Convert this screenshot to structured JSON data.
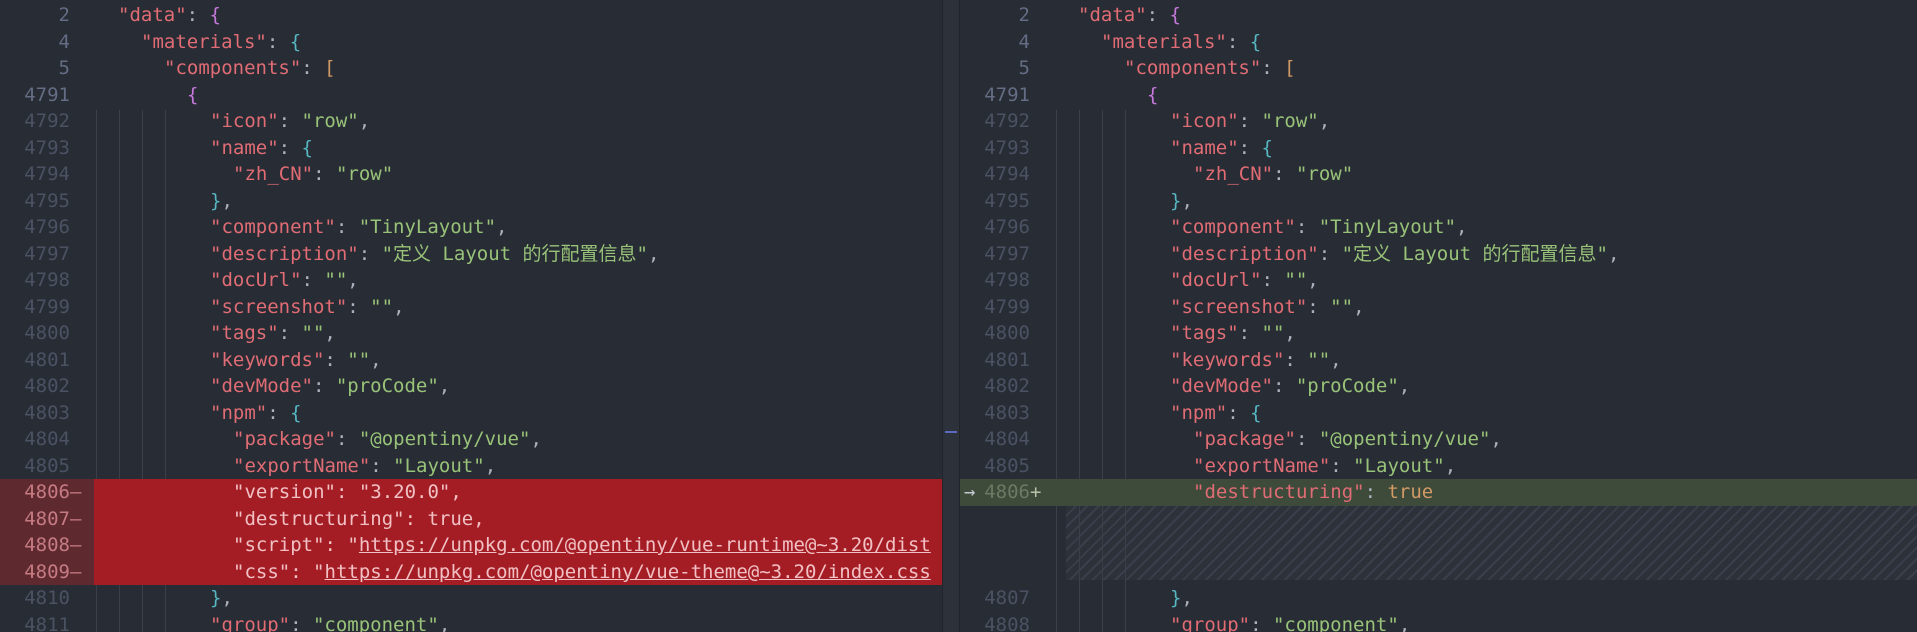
{
  "left": {
    "lines": [
      {
        "num": "2",
        "sign": "",
        "type": "ctx",
        "top": true,
        "indent": 0,
        "tokens": [
          {
            "t": "\"data\"",
            "c": "k"
          },
          {
            "t": ": ",
            "c": "p"
          },
          {
            "t": "{",
            "c": "b1"
          }
        ]
      },
      {
        "num": "4",
        "sign": "",
        "type": "ctx",
        "top": true,
        "indent": 1,
        "tokens": [
          {
            "t": "\"materials\"",
            "c": "k"
          },
          {
            "t": ": ",
            "c": "p"
          },
          {
            "t": "{",
            "c": "b2"
          }
        ]
      },
      {
        "num": "5",
        "sign": "",
        "type": "ctx",
        "top": true,
        "indent": 2,
        "tokens": [
          {
            "t": "\"components\"",
            "c": "k"
          },
          {
            "t": ": ",
            "c": "p"
          },
          {
            "t": "[",
            "c": "b3"
          }
        ]
      },
      {
        "num": "4791",
        "sign": "",
        "type": "ctx",
        "top": true,
        "indent": 3,
        "tokens": [
          {
            "t": "{",
            "c": "b1"
          }
        ]
      },
      {
        "num": "4792",
        "sign": "",
        "type": "ctx",
        "indent": 4,
        "tokens": [
          {
            "t": "\"icon\"",
            "c": "k"
          },
          {
            "t": ": ",
            "c": "p"
          },
          {
            "t": "\"row\"",
            "c": "s"
          },
          {
            "t": ",",
            "c": "p"
          }
        ]
      },
      {
        "num": "4793",
        "sign": "",
        "type": "ctx",
        "indent": 4,
        "tokens": [
          {
            "t": "\"name\"",
            "c": "k"
          },
          {
            "t": ": ",
            "c": "p"
          },
          {
            "t": "{",
            "c": "b2"
          }
        ]
      },
      {
        "num": "4794",
        "sign": "",
        "type": "ctx",
        "indent": 5,
        "tokens": [
          {
            "t": "\"zh_CN\"",
            "c": "k"
          },
          {
            "t": ": ",
            "c": "p"
          },
          {
            "t": "\"row\"",
            "c": "s"
          }
        ]
      },
      {
        "num": "4795",
        "sign": "",
        "type": "ctx",
        "indent": 4,
        "tokens": [
          {
            "t": "}",
            "c": "b2"
          },
          {
            "t": ",",
            "c": "p"
          }
        ]
      },
      {
        "num": "4796",
        "sign": "",
        "type": "ctx",
        "indent": 4,
        "tokens": [
          {
            "t": "\"component\"",
            "c": "k"
          },
          {
            "t": ": ",
            "c": "p"
          },
          {
            "t": "\"TinyLayout\"",
            "c": "s"
          },
          {
            "t": ",",
            "c": "p"
          }
        ]
      },
      {
        "num": "4797",
        "sign": "",
        "type": "ctx",
        "indent": 4,
        "tokens": [
          {
            "t": "\"description\"",
            "c": "k"
          },
          {
            "t": ": ",
            "c": "p"
          },
          {
            "t": "\"定义 Layout 的行配置信息\"",
            "c": "s"
          },
          {
            "t": ",",
            "c": "p"
          }
        ]
      },
      {
        "num": "4798",
        "sign": "",
        "type": "ctx",
        "indent": 4,
        "tokens": [
          {
            "t": "\"docUrl\"",
            "c": "k"
          },
          {
            "t": ": ",
            "c": "p"
          },
          {
            "t": "\"\"",
            "c": "s"
          },
          {
            "t": ",",
            "c": "p"
          }
        ]
      },
      {
        "num": "4799",
        "sign": "",
        "type": "ctx",
        "indent": 4,
        "tokens": [
          {
            "t": "\"screenshot\"",
            "c": "k"
          },
          {
            "t": ": ",
            "c": "p"
          },
          {
            "t": "\"\"",
            "c": "s"
          },
          {
            "t": ",",
            "c": "p"
          }
        ]
      },
      {
        "num": "4800",
        "sign": "",
        "type": "ctx",
        "indent": 4,
        "tokens": [
          {
            "t": "\"tags\"",
            "c": "k"
          },
          {
            "t": ": ",
            "c": "p"
          },
          {
            "t": "\"\"",
            "c": "s"
          },
          {
            "t": ",",
            "c": "p"
          }
        ]
      },
      {
        "num": "4801",
        "sign": "",
        "type": "ctx",
        "indent": 4,
        "tokens": [
          {
            "t": "\"keywords\"",
            "c": "k"
          },
          {
            "t": ": ",
            "c": "p"
          },
          {
            "t": "\"\"",
            "c": "s"
          },
          {
            "t": ",",
            "c": "p"
          }
        ]
      },
      {
        "num": "4802",
        "sign": "",
        "type": "ctx",
        "indent": 4,
        "tokens": [
          {
            "t": "\"devMode\"",
            "c": "k"
          },
          {
            "t": ": ",
            "c": "p"
          },
          {
            "t": "\"proCode\"",
            "c": "s"
          },
          {
            "t": ",",
            "c": "p"
          }
        ]
      },
      {
        "num": "4803",
        "sign": "",
        "type": "ctx",
        "indent": 4,
        "tokens": [
          {
            "t": "\"npm\"",
            "c": "k"
          },
          {
            "t": ": ",
            "c": "p"
          },
          {
            "t": "{",
            "c": "b2"
          }
        ]
      },
      {
        "num": "4804",
        "sign": "",
        "type": "ctx",
        "indent": 5,
        "tokens": [
          {
            "t": "\"package\"",
            "c": "k"
          },
          {
            "t": ": ",
            "c": "p"
          },
          {
            "t": "\"@opentiny/vue\"",
            "c": "s"
          },
          {
            "t": ",",
            "c": "p"
          }
        ]
      },
      {
        "num": "4805",
        "sign": "",
        "type": "ctx",
        "indent": 5,
        "tokens": [
          {
            "t": "\"exportName\"",
            "c": "k"
          },
          {
            "t": ": ",
            "c": "p"
          },
          {
            "t": "\"Layout\"",
            "c": "s"
          },
          {
            "t": ",",
            "c": "p"
          }
        ]
      },
      {
        "num": "4806",
        "sign": "–",
        "type": "del",
        "indent": 5,
        "tokens": [
          {
            "t": "\"version\"",
            "c": "k"
          },
          {
            "t": ": ",
            "c": "p"
          },
          {
            "t": "\"3.20.0\"",
            "c": "s"
          },
          {
            "t": ",",
            "c": "p"
          }
        ]
      },
      {
        "num": "4807",
        "sign": "–",
        "type": "del",
        "indent": 5,
        "tokens": [
          {
            "t": "\"destructuring\"",
            "c": "k"
          },
          {
            "t": ": ",
            "c": "p"
          },
          {
            "t": "true",
            "c": "p"
          },
          {
            "t": ",",
            "c": "p"
          }
        ]
      },
      {
        "num": "4808",
        "sign": "–",
        "type": "del",
        "indent": 5,
        "tokens": [
          {
            "t": "\"script\"",
            "c": "k"
          },
          {
            "t": ": ",
            "c": "p"
          },
          {
            "t": "\"",
            "c": "s"
          },
          {
            "t": "https://unpkg.com/@opentiny/vue-runtime@~3.20/dist",
            "c": "s url"
          }
        ]
      },
      {
        "num": "4809",
        "sign": "–",
        "type": "del",
        "indent": 5,
        "tokens": [
          {
            "t": "\"css\"",
            "c": "k"
          },
          {
            "t": ": ",
            "c": "p"
          },
          {
            "t": "\"",
            "c": "s"
          },
          {
            "t": "https://unpkg.com/@opentiny/vue-theme@~3.20/index.css",
            "c": "s url"
          }
        ]
      },
      {
        "num": "4810",
        "sign": "",
        "type": "ctx",
        "indent": 4,
        "tokens": [
          {
            "t": "}",
            "c": "b2"
          },
          {
            "t": ",",
            "c": "p"
          }
        ]
      },
      {
        "num": "4811",
        "sign": "",
        "type": "ctx",
        "indent": 4,
        "tokens": [
          {
            "t": "\"group\"",
            "c": "k"
          },
          {
            "t": ": ",
            "c": "p"
          },
          {
            "t": "\"component\"",
            "c": "s"
          },
          {
            "t": ",",
            "c": "p"
          }
        ]
      }
    ]
  },
  "right": {
    "lines": [
      {
        "num": "2",
        "sign": "",
        "type": "ctx",
        "top": true,
        "indent": 0,
        "tokens": [
          {
            "t": "\"data\"",
            "c": "k"
          },
          {
            "t": ": ",
            "c": "p"
          },
          {
            "t": "{",
            "c": "b1"
          }
        ]
      },
      {
        "num": "4",
        "sign": "",
        "type": "ctx",
        "top": true,
        "indent": 1,
        "tokens": [
          {
            "t": "\"materials\"",
            "c": "k"
          },
          {
            "t": ": ",
            "c": "p"
          },
          {
            "t": "{",
            "c": "b2"
          }
        ]
      },
      {
        "num": "5",
        "sign": "",
        "type": "ctx",
        "top": true,
        "indent": 2,
        "tokens": [
          {
            "t": "\"components\"",
            "c": "k"
          },
          {
            "t": ": ",
            "c": "p"
          },
          {
            "t": "[",
            "c": "b3"
          }
        ]
      },
      {
        "num": "4791",
        "sign": "",
        "type": "ctx",
        "top": true,
        "indent": 3,
        "tokens": [
          {
            "t": "{",
            "c": "b1"
          }
        ]
      },
      {
        "num": "4792",
        "sign": "",
        "type": "ctx",
        "indent": 4,
        "tokens": [
          {
            "t": "\"icon\"",
            "c": "k"
          },
          {
            "t": ": ",
            "c": "p"
          },
          {
            "t": "\"row\"",
            "c": "s"
          },
          {
            "t": ",",
            "c": "p"
          }
        ]
      },
      {
        "num": "4793",
        "sign": "",
        "type": "ctx",
        "indent": 4,
        "tokens": [
          {
            "t": "\"name\"",
            "c": "k"
          },
          {
            "t": ": ",
            "c": "p"
          },
          {
            "t": "{",
            "c": "b2"
          }
        ]
      },
      {
        "num": "4794",
        "sign": "",
        "type": "ctx",
        "indent": 5,
        "tokens": [
          {
            "t": "\"zh_CN\"",
            "c": "k"
          },
          {
            "t": ": ",
            "c": "p"
          },
          {
            "t": "\"row\"",
            "c": "s"
          }
        ]
      },
      {
        "num": "4795",
        "sign": "",
        "type": "ctx",
        "indent": 4,
        "tokens": [
          {
            "t": "}",
            "c": "b2"
          },
          {
            "t": ",",
            "c": "p"
          }
        ]
      },
      {
        "num": "4796",
        "sign": "",
        "type": "ctx",
        "indent": 4,
        "tokens": [
          {
            "t": "\"component\"",
            "c": "k"
          },
          {
            "t": ": ",
            "c": "p"
          },
          {
            "t": "\"TinyLayout\"",
            "c": "s"
          },
          {
            "t": ",",
            "c": "p"
          }
        ]
      },
      {
        "num": "4797",
        "sign": "",
        "type": "ctx",
        "indent": 4,
        "tokens": [
          {
            "t": "\"description\"",
            "c": "k"
          },
          {
            "t": ": ",
            "c": "p"
          },
          {
            "t": "\"定义 Layout 的行配置信息\"",
            "c": "s"
          },
          {
            "t": ",",
            "c": "p"
          }
        ]
      },
      {
        "num": "4798",
        "sign": "",
        "type": "ctx",
        "indent": 4,
        "tokens": [
          {
            "t": "\"docUrl\"",
            "c": "k"
          },
          {
            "t": ": ",
            "c": "p"
          },
          {
            "t": "\"\"",
            "c": "s"
          },
          {
            "t": ",",
            "c": "p"
          }
        ]
      },
      {
        "num": "4799",
        "sign": "",
        "type": "ctx",
        "indent": 4,
        "tokens": [
          {
            "t": "\"screenshot\"",
            "c": "k"
          },
          {
            "t": ": ",
            "c": "p"
          },
          {
            "t": "\"\"",
            "c": "s"
          },
          {
            "t": ",",
            "c": "p"
          }
        ]
      },
      {
        "num": "4800",
        "sign": "",
        "type": "ctx",
        "indent": 4,
        "tokens": [
          {
            "t": "\"tags\"",
            "c": "k"
          },
          {
            "t": ": ",
            "c": "p"
          },
          {
            "t": "\"\"",
            "c": "s"
          },
          {
            "t": ",",
            "c": "p"
          }
        ]
      },
      {
        "num": "4801",
        "sign": "",
        "type": "ctx",
        "indent": 4,
        "tokens": [
          {
            "t": "\"keywords\"",
            "c": "k"
          },
          {
            "t": ": ",
            "c": "p"
          },
          {
            "t": "\"\"",
            "c": "s"
          },
          {
            "t": ",",
            "c": "p"
          }
        ]
      },
      {
        "num": "4802",
        "sign": "",
        "type": "ctx",
        "indent": 4,
        "tokens": [
          {
            "t": "\"devMode\"",
            "c": "k"
          },
          {
            "t": ": ",
            "c": "p"
          },
          {
            "t": "\"proCode\"",
            "c": "s"
          },
          {
            "t": ",",
            "c": "p"
          }
        ]
      },
      {
        "num": "4803",
        "sign": "",
        "type": "ctx",
        "indent": 4,
        "tokens": [
          {
            "t": "\"npm\"",
            "c": "k"
          },
          {
            "t": ": ",
            "c": "p"
          },
          {
            "t": "{",
            "c": "b2"
          }
        ]
      },
      {
        "num": "4804",
        "sign": "",
        "type": "ctx",
        "indent": 5,
        "tokens": [
          {
            "t": "\"package\"",
            "c": "k"
          },
          {
            "t": ": ",
            "c": "p"
          },
          {
            "t": "\"@opentiny/vue\"",
            "c": "s"
          },
          {
            "t": ",",
            "c": "p"
          }
        ]
      },
      {
        "num": "4805",
        "sign": "",
        "type": "ctx",
        "indent": 5,
        "tokens": [
          {
            "t": "\"exportName\"",
            "c": "k"
          },
          {
            "t": ": ",
            "c": "p"
          },
          {
            "t": "\"Layout\"",
            "c": "s"
          },
          {
            "t": ",",
            "c": "p"
          }
        ]
      },
      {
        "num": "4806",
        "sign": "+",
        "type": "add",
        "arrow": "→",
        "indent": 5,
        "tokens": [
          {
            "t": "\"destructuring\"",
            "c": "k"
          },
          {
            "t": ": ",
            "c": "p"
          },
          {
            "t": "true",
            "c": "b3"
          }
        ]
      },
      {
        "num": "",
        "sign": "",
        "type": "pad"
      },
      {
        "num": "",
        "sign": "",
        "type": "pad"
      },
      {
        "num": "",
        "sign": "",
        "type": "pad"
      },
      {
        "num": "4807",
        "sign": "",
        "type": "ctx",
        "indent": 4,
        "tokens": [
          {
            "t": "}",
            "c": "b2"
          },
          {
            "t": ",",
            "c": "p"
          }
        ]
      },
      {
        "num": "4808",
        "sign": "",
        "type": "ctx",
        "indent": 4,
        "tokens": [
          {
            "t": "\"group\"",
            "c": "k"
          },
          {
            "t": ": ",
            "c": "p"
          },
          {
            "t": "\"component\"",
            "c": "s"
          },
          {
            "t": ",",
            "c": "p"
          }
        ]
      }
    ]
  },
  "colors": {
    "background": "#282c34",
    "deleted": "#a51d24",
    "added": "#3e4a3a",
    "key": "#e06c75",
    "string": "#98c379"
  },
  "icons": {
    "arrow": "arrow-right-icon",
    "divider_mark": "minus-icon"
  }
}
